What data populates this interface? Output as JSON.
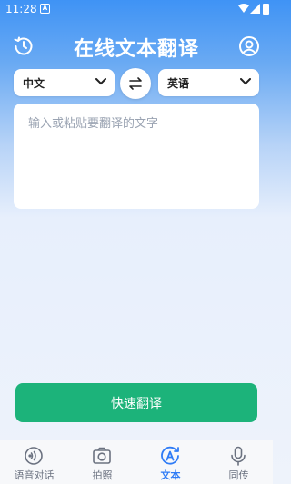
{
  "status_bar": {
    "time": "11:28",
    "notif_letter": "A"
  },
  "header": {
    "title": "在线文本翻译",
    "history_icon": "history-icon",
    "profile_icon": "profile-icon"
  },
  "languages": {
    "source": "中文",
    "target": "英语",
    "swap_icon": "swap-arrows-icon"
  },
  "input": {
    "placeholder": "输入或粘贴要翻译的文字",
    "value": ""
  },
  "translate_button": {
    "label": "快速翻译"
  },
  "colors": {
    "accent_blue": "#2f7cf6",
    "button_green": "#1cb37a",
    "header_blue": "#3f93f5"
  },
  "bottom_nav": {
    "items": [
      {
        "label": "语音对话",
        "icon": "voice-chat-icon",
        "active": false
      },
      {
        "label": "拍照",
        "icon": "camera-icon",
        "active": false
      },
      {
        "label": "文本",
        "icon": "text-translate-icon",
        "active": true
      },
      {
        "label": "同传",
        "icon": "microphone-icon",
        "active": false
      }
    ]
  }
}
